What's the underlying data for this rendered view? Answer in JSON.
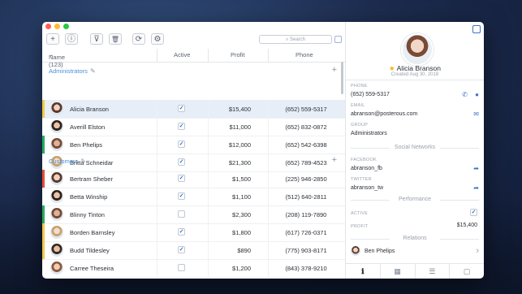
{
  "toolbar": {
    "add": "+",
    "info": "ⓘ",
    "filter": "⊽",
    "delete": "🗑",
    "refresh": "⟳",
    "settings": "⚙",
    "search_placeholder": "Search"
  },
  "columns": {
    "name": "Name (123)",
    "sort": "⌃",
    "active": "Active",
    "profit": "Profit",
    "phone": "Phone"
  },
  "groups": {
    "admins": "Administrators",
    "customers": "Customers",
    "add": "+",
    "edit": "✎"
  },
  "admins": [
    {
      "name": "Alicia Branson",
      "active": true,
      "profit": "$15,400",
      "phone": "(652) 559-5317",
      "color": "#f2c94c",
      "selected": true
    },
    {
      "name": "Averill Elston",
      "active": true,
      "profit": "$11,000",
      "phone": "(652) 832-0872",
      "color": "",
      "selected": false
    },
    {
      "name": "Ben Phelips",
      "active": true,
      "profit": "$12,000",
      "phone": "(652) 542-6398",
      "color": "#27ae60",
      "selected": false
    },
    {
      "name": "Britta Schneidar",
      "active": true,
      "profit": "$21,300",
      "phone": "(652) 789-4523",
      "color": "",
      "selected": false
    }
  ],
  "customers": [
    {
      "name": "Bertram Sheber",
      "active": true,
      "profit": "$1,500",
      "phone": "(225) 946-2850",
      "color": "#e74c3c"
    },
    {
      "name": "Betta Winship",
      "active": true,
      "profit": "$1,100",
      "phone": "(512) 640-2811",
      "color": ""
    },
    {
      "name": "Blinny Tinton",
      "active": false,
      "profit": "$2,300",
      "phone": "(208) 119-7890",
      "color": "#27ae60"
    },
    {
      "name": "Borden Barnsley",
      "active": true,
      "profit": "$1,800",
      "phone": "(617) 726-0371",
      "color": "#f2c94c"
    },
    {
      "name": "Budd Tildesley",
      "active": true,
      "profit": "$890",
      "phone": "(775) 903-8171",
      "color": "#f2c94c"
    },
    {
      "name": "Carree Theseira",
      "active": false,
      "profit": "$1,200",
      "phone": "(843) 378-9210",
      "color": ""
    }
  ],
  "detail": {
    "name": "Alicia Branson",
    "star": "★",
    "created": "Created Aug 30, 2018",
    "phone_label": "PHONE",
    "phone": "(652) 559-5317",
    "email_label": "EMAIL",
    "email": "abranson@posterous.com",
    "group_label": "GROUP",
    "group": "Administrators",
    "social_heading": "Social Networks",
    "facebook_label": "FACEBOOK",
    "facebook": "abranson_fb",
    "twitter_label": "TWITTER",
    "twitter": "abranson_tw",
    "performance_heading": "Performance",
    "active_label": "ACTIVE",
    "active_check": "✓",
    "profit_label": "PROFIT",
    "profit": "$15,400",
    "relations_heading": "Relations",
    "relation": "Ben Phelips",
    "chevron": "›",
    "icons": {
      "call": "✆",
      "message": "●",
      "mail": "✉",
      "share": "➦"
    }
  },
  "tabs": {
    "info": "ℹ",
    "calendar": "▦",
    "tasks": "☰",
    "notes": "▢"
  }
}
